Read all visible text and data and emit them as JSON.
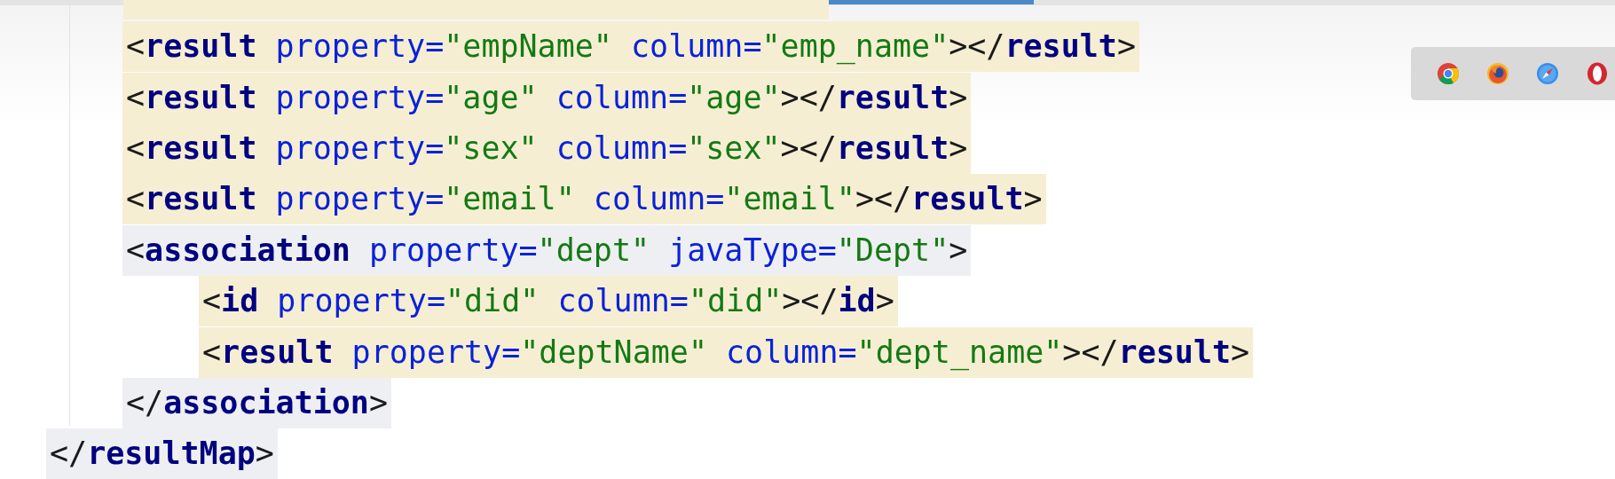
{
  "editor": {
    "result_map": {
      "children": [
        {
          "text": "<result property=\"empName\" column=\"emp_name\"></result>",
          "color": "#f6eed2"
        },
        {
          "text": "<result property=\"age\" column=\"age\"></result>",
          "color": "#f6eed2"
        },
        {
          "text": "<result property=\"sex\" column=\"sex\"></result>",
          "color": "#f6eed2"
        },
        {
          "text": "<result property=\"email\" column=\"email\"></result>",
          "color": "#f6eed2"
        },
        {
          "text": "<association property=\"dept\" javaType=\"Dept\">",
          "color": "#eeeff2",
          "children": [
            {
              "text": "<id property=\"did\" column=\"did\"></id>",
              "color": "#f6eed2"
            },
            {
              "text": "<result property=\"deptName\" column=\"dept_name\"></result>",
              "color": "#f6eed2"
            }
          ]
        },
        {
          "text": "</association>",
          "color": "#eeeff2"
        }
      ],
      "closing": {
        "text": "</resultMap>",
        "color": "#eeeff2"
      }
    }
  },
  "browser_bar": {
    "browsers": [
      {
        "kind": "chrome"
      },
      {
        "kind": "firefox"
      },
      {
        "kind": "safari"
      },
      {
        "kind": "opera"
      }
    ]
  }
}
